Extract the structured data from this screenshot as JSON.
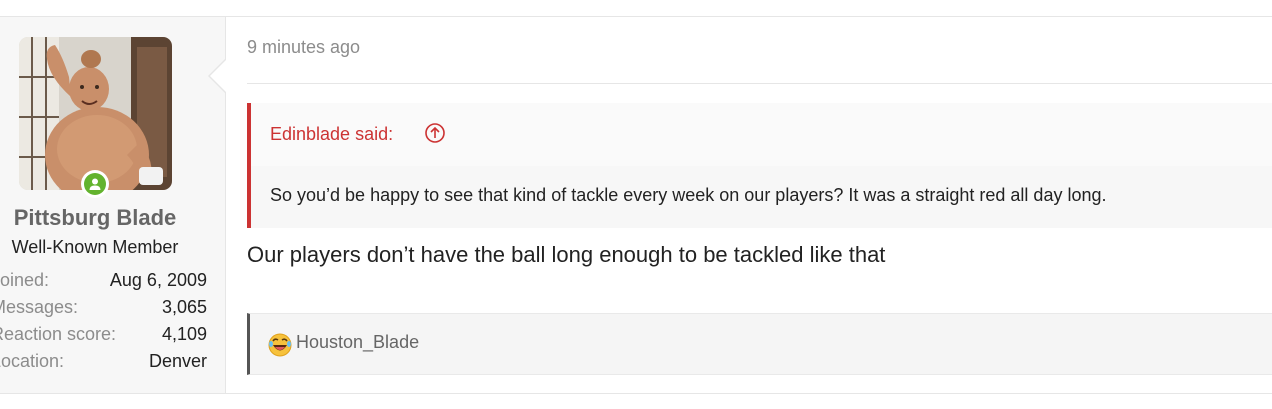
{
  "author": {
    "username": "Pittsburg Blade",
    "title": "Well-Known Member",
    "status": "online",
    "stats": [
      {
        "label": "Joined:",
        "value": "Aug 6, 2009"
      },
      {
        "label": "Messages:",
        "value": "3,065"
      },
      {
        "label": "Reaction score:",
        "value": "4,109"
      },
      {
        "label": "Location:",
        "value": "Denver"
      }
    ]
  },
  "post": {
    "time": "9 minutes ago",
    "quote": {
      "author_label": "Edinblade said:",
      "text": "So you’d be happy to see that kind of tackle every week on our players? It was a straight red all day long."
    },
    "body": "Our players don’t have the ball long enough to be tackled like that",
    "reactions": {
      "icon": "laughing-emoji-icon",
      "users": "Houston_Blade"
    }
  },
  "colors": {
    "quote_accent": "#cc3333",
    "online": "#63b32e",
    "reaction_bar": "#555555"
  }
}
